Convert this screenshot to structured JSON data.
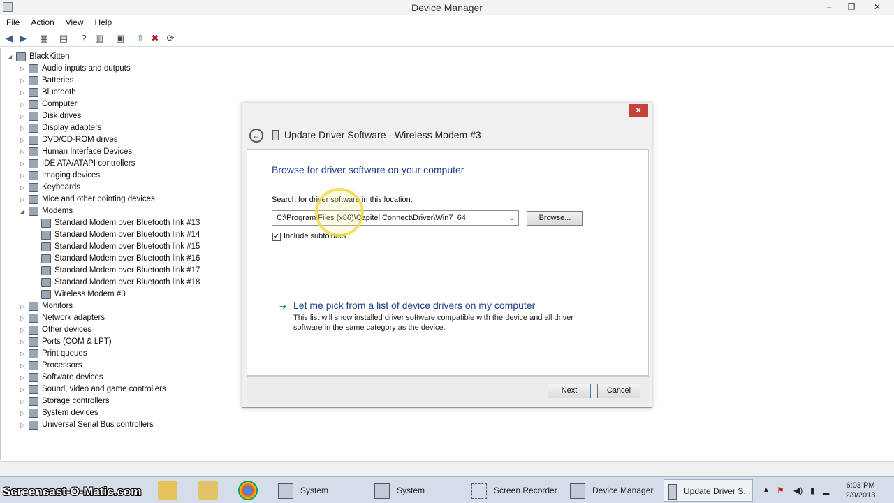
{
  "window": {
    "title": "Device Manager",
    "controls": {
      "minimize": "–",
      "maximize": "❐",
      "close": "✕"
    }
  },
  "menu": [
    "File",
    "Action",
    "View",
    "Help"
  ],
  "toolbar": {
    "icons": [
      "back-icon",
      "forward-icon",
      "show-hide-tree-icon",
      "properties-icon",
      "help-icon",
      "view-icon",
      "computer-icon",
      "update-driver-icon",
      "uninstall-icon",
      "scan-changes-icon"
    ]
  },
  "tree": {
    "root": "BlackKitten",
    "categories": [
      {
        "label": "Audio inputs and outputs"
      },
      {
        "label": "Batteries"
      },
      {
        "label": "Bluetooth"
      },
      {
        "label": "Computer"
      },
      {
        "label": "Disk drives"
      },
      {
        "label": "Display adapters"
      },
      {
        "label": "DVD/CD-ROM drives"
      },
      {
        "label": "Human Interface Devices"
      },
      {
        "label": "IDE ATA/ATAPI controllers"
      },
      {
        "label": "Imaging devices"
      },
      {
        "label": "Keyboards"
      },
      {
        "label": "Mice and other pointing devices"
      },
      {
        "label": "Modems",
        "expanded": true,
        "children": [
          "Standard Modem over Bluetooth link #13",
          "Standard Modem over Bluetooth link #14",
          "Standard Modem over Bluetooth link #15",
          "Standard Modem over Bluetooth link #16",
          "Standard Modem over Bluetooth link #17",
          "Standard Modem over Bluetooth link #18",
          "Wireless Modem #3"
        ]
      },
      {
        "label": "Monitors"
      },
      {
        "label": "Network adapters"
      },
      {
        "label": "Other devices"
      },
      {
        "label": "Ports (COM & LPT)"
      },
      {
        "label": "Print queues"
      },
      {
        "label": "Processors"
      },
      {
        "label": "Software devices"
      },
      {
        "label": "Sound, video and game controllers"
      },
      {
        "label": "Storage controllers"
      },
      {
        "label": "System devices"
      },
      {
        "label": "Universal Serial Bus controllers"
      }
    ]
  },
  "dialog": {
    "title": "Update Driver Software - Wireless Modem #3",
    "close": "✕",
    "back": "←",
    "heading": "Browse for driver software on your computer",
    "search_label": "Search for driver software in this location:",
    "path_value": "C:\\Program Files (x86)\\Capitel Connect\\Driver\\Win7_64",
    "dropdown": "⌄",
    "browse_label": "Browse...",
    "include_subfolders_label": "Include subfolders",
    "include_subfolders_checked": "✓",
    "pick_arrow": "➜",
    "pick_link": "Let me pick from a list of device drivers on my computer",
    "pick_desc": "This list will show installed driver software compatible with the device and all driver software in the same category as the device.",
    "next_label": "Next",
    "cancel_label": "Cancel"
  },
  "taskbar": {
    "watermark": "Screencast-O-Matic.com",
    "tasks": [
      "System",
      "System",
      "Screen Recorder",
      "Device Manager",
      "Update Driver S..."
    ],
    "clock": {
      "time": "6:03 PM",
      "date": "2/9/2013"
    },
    "tray_icons": [
      "chevron-up-icon",
      "network-icon",
      "volume-icon",
      "battery-icon",
      "flag-icon"
    ]
  },
  "colors": {
    "link_blue": "#1e3f8a",
    "close_red": "#c7423c",
    "taskbar": "#d4dde8"
  }
}
